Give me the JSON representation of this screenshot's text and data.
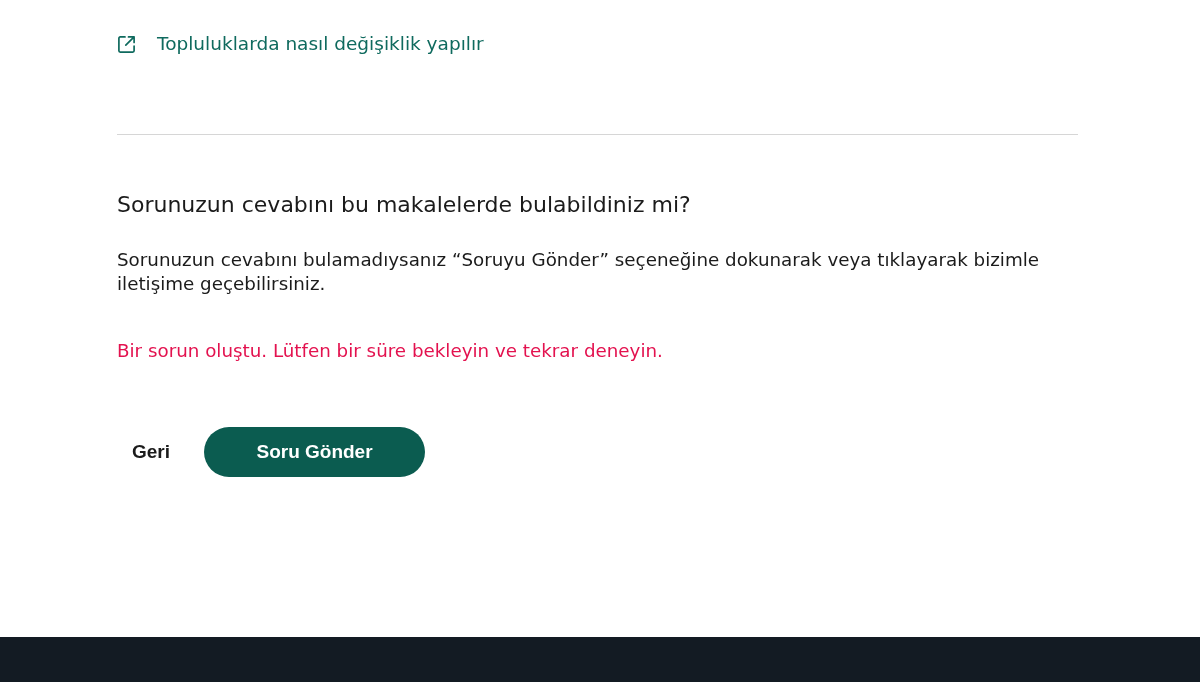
{
  "link": {
    "label": "Topluluklarda nasıl değişiklik yapılır"
  },
  "feedback": {
    "question": "Sorunuzun cevabını bu makalelerde bulabildiniz mi?",
    "description": "Sorunuzun cevabını bulamadıysanız “Soruyu Gönder” seçeneğine dokunarak veya tıklayarak bizimle iletişime geçebilirsiniz.",
    "error": "Bir sorun oluştu. Lütfen bir süre bekleyin ve tekrar deneyin."
  },
  "actions": [
    {
      "label": "Geri",
      "kind": "text"
    },
    {
      "label": "Soru Gönder",
      "kind": "primary"
    }
  ]
}
